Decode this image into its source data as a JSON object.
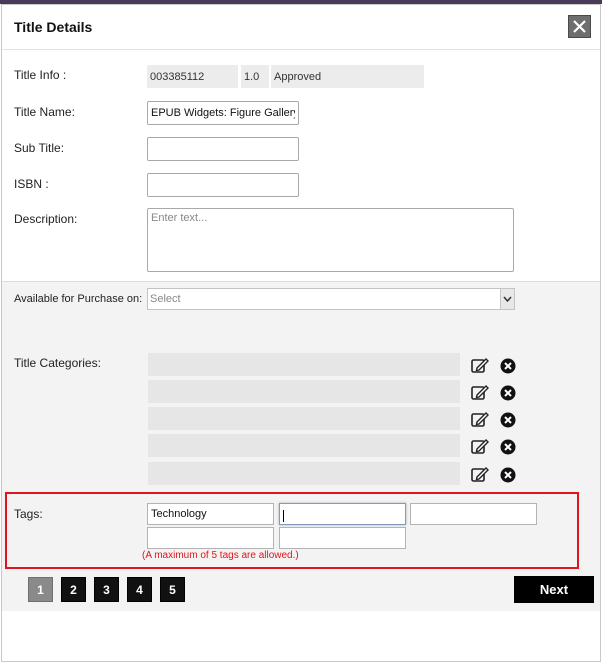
{
  "dialog": {
    "title": "Title Details",
    "close_icon": "close-icon"
  },
  "title_info": {
    "label": "Title Info :",
    "id": "003385112",
    "version": "1.0",
    "status": "Approved"
  },
  "title_name": {
    "label": "Title Name:",
    "value": "EPUB Widgets: Figure Gallery"
  },
  "sub_title": {
    "label": "Sub Title:",
    "value": ""
  },
  "isbn": {
    "label": "ISBN :",
    "value": ""
  },
  "description": {
    "label": "Description:",
    "placeholder": "Enter text..."
  },
  "purchase": {
    "label": "Available for Purchase on:",
    "selected": "Select"
  },
  "categories": {
    "label": "Title Categories:",
    "rows": [
      "",
      "",
      "",
      "",
      ""
    ],
    "edit_icon": "edit-icon",
    "remove_icon": "remove-icon"
  },
  "tags": {
    "label": "Tags:",
    "values": [
      "Technology",
      "",
      "",
      "",
      ""
    ],
    "note": "(A maximum of 5 tags are allowed.)",
    "highlight_color": "#e0141c"
  },
  "pagination": {
    "pages": [
      "1",
      "2",
      "3",
      "4",
      "5"
    ],
    "current_page": "1",
    "next_label": "Next"
  }
}
